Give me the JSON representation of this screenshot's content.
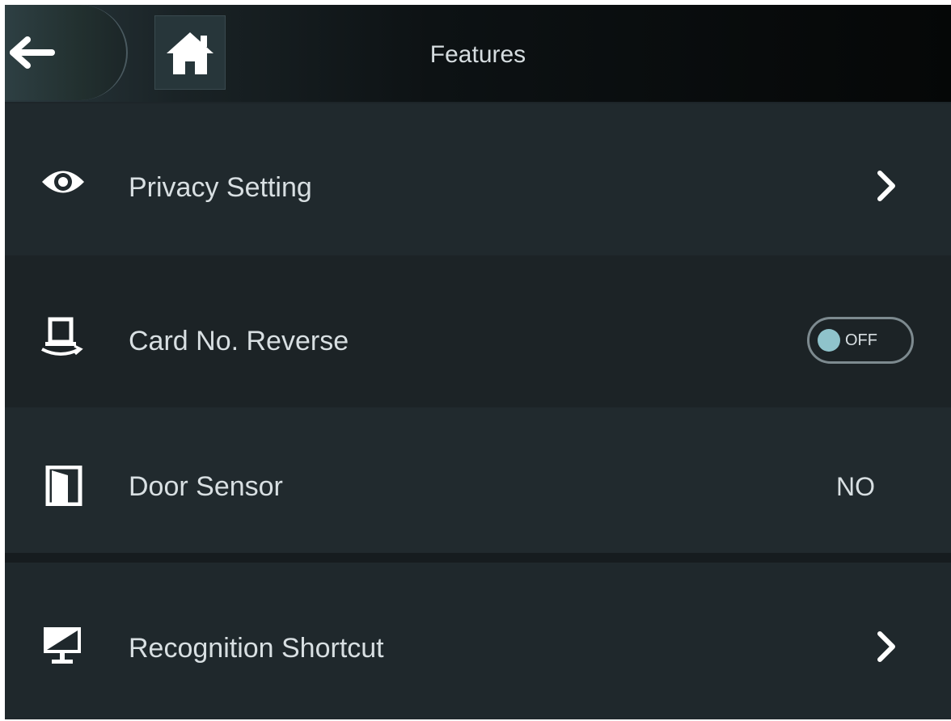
{
  "header": {
    "title": "Features",
    "back_icon": "arrow-left-icon",
    "home_icon": "home-icon"
  },
  "items": [
    {
      "label": "Privacy Setting",
      "icon": "eye-icon",
      "control": "chevron"
    },
    {
      "label": "Card No. Reverse",
      "icon": "card-reverse-icon",
      "control": "toggle",
      "toggle_text": "OFF",
      "toggle_state": "off"
    },
    {
      "label": "Door Sensor",
      "icon": "door-icon",
      "control": "value",
      "value": "NO"
    },
    {
      "label": "Recognition Shortcut",
      "icon": "monitor-icon",
      "control": "chevron"
    }
  ],
  "colors": {
    "background": "#1d2529",
    "text": "#d8dfe2",
    "toggle_knob": "#8fc3cb"
  }
}
